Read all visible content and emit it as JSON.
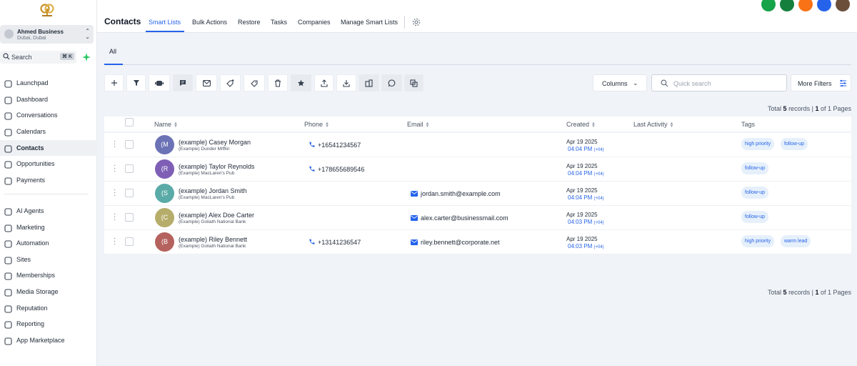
{
  "brand": {
    "logo_icon": "company-logo-icon",
    "accent": "#2563eb"
  },
  "account": {
    "name": "Ahmed Business",
    "location": "Dubai, Dubai"
  },
  "search": {
    "label": "Search",
    "shortcut": "⌘ K"
  },
  "sidebar": {
    "items": [
      {
        "label": "Launchpad",
        "icon": "rocket-icon",
        "active": false
      },
      {
        "label": "Dashboard",
        "icon": "grid-icon",
        "active": false
      },
      {
        "label": "Conversations",
        "icon": "chat-icon",
        "active": false
      },
      {
        "label": "Calendars",
        "icon": "calendar-icon",
        "active": false
      },
      {
        "label": "Contacts",
        "icon": "contacts-icon",
        "active": true
      },
      {
        "label": "Opportunities",
        "icon": "opportunities-icon",
        "active": false
      },
      {
        "label": "Payments",
        "icon": "payments-icon",
        "active": false
      },
      {
        "label": "AI Agents",
        "icon": "ai-agents-icon",
        "active": false
      },
      {
        "label": "Marketing",
        "icon": "marketing-icon",
        "active": false
      },
      {
        "label": "Automation",
        "icon": "automation-icon",
        "active": false
      },
      {
        "label": "Sites",
        "icon": "sites-icon",
        "active": false
      },
      {
        "label": "Memberships",
        "icon": "memberships-icon",
        "active": false
      },
      {
        "label": "Media Storage",
        "icon": "media-icon",
        "active": false
      },
      {
        "label": "Reputation",
        "icon": "star-icon",
        "active": false
      },
      {
        "label": "Reporting",
        "icon": "reporting-icon",
        "active": false
      },
      {
        "label": "App Marketplace",
        "icon": "marketplace-icon",
        "active": false
      }
    ]
  },
  "header": {
    "title": "Contacts",
    "tabs": [
      {
        "label": "Smart Lists",
        "active": true
      },
      {
        "label": "Bulk Actions",
        "active": false
      },
      {
        "label": "Restore",
        "active": false
      },
      {
        "label": "Tasks",
        "active": false
      },
      {
        "label": "Companies",
        "active": false
      },
      {
        "label": "Manage Smart Lists",
        "active": false
      }
    ],
    "top_buttons": [
      {
        "icon": "phone-icon",
        "color": "#16a34a"
      },
      {
        "icon": "megaphone-icon",
        "color": "#15803d"
      },
      {
        "icon": "bell-icon",
        "color": "#f97316"
      },
      {
        "icon": "help-icon",
        "color": "#2563eb"
      },
      {
        "icon": "user-avatar-icon",
        "color": "#6b4f3a"
      }
    ]
  },
  "list": {
    "view_tab": "All",
    "columns_button": "Columns",
    "quick_search_placeholder": "Quick search",
    "more_filters": "More Filters",
    "toolbar_icons": [
      "add-icon",
      "filter-icon",
      "robot-icon",
      "message-icon",
      "email-icon",
      "tag-add-icon",
      "tag-remove-icon",
      "delete-icon",
      "star-icon",
      "export-icon",
      "import-icon",
      "company-icon",
      "whatsapp-icon",
      "merge-icon"
    ]
  },
  "pagination": {
    "prefix": "Total",
    "count": "5",
    "records": "records |",
    "page": "1",
    "of": "of 1 Pages"
  },
  "table": {
    "headers": {
      "name": "Name",
      "phone": "Phone",
      "email": "Email",
      "created": "Created",
      "last_activity": "Last Activity",
      "tags": "Tags"
    },
    "rows": [
      {
        "initial": "(M",
        "avatar_color": "#6b72b5",
        "name": "(example) Casey Morgan",
        "company": "(Example) Dunder Mifflin",
        "phone": "+16541234567",
        "email": "",
        "created_date": "Apr 19 2025",
        "created_time": "04:04 PM",
        "tz": "(+04)",
        "tags": [
          "high priority",
          "follow-up"
        ]
      },
      {
        "initial": "(R",
        "avatar_color": "#7e5fb5",
        "name": "(example) Taylor Reynolds",
        "company": "(Example) MacLaren's Pub",
        "phone": "+178655689546",
        "email": "",
        "created_date": "Apr 19 2025",
        "created_time": "04:04 PM",
        "tz": "(+04)",
        "tags": [
          "follow-up"
        ]
      },
      {
        "initial": "(S",
        "avatar_color": "#5aaba8",
        "name": "(example) Jordan Smith",
        "company": "(Example) MacLaren's Pub",
        "phone": "",
        "email": "jordan.smith@example.com",
        "created_date": "Apr 19 2025",
        "created_time": "04:04 PM",
        "tz": "(+04)",
        "tags": [
          "follow-up"
        ]
      },
      {
        "initial": "(C",
        "avatar_color": "#b6ad6b",
        "name": "(example) Alex Doe Carter",
        "company": "(Example) Goliath National Bank",
        "phone": "",
        "email": "alex.carter@businessmail.com",
        "created_date": "Apr 19 2025",
        "created_time": "04:03 PM",
        "tz": "(+04)",
        "tags": [
          "follow-up"
        ]
      },
      {
        "initial": "(B",
        "avatar_color": "#b5625e",
        "name": "(example) Riley Bennett",
        "company": "(Example) Goliath National Bank",
        "phone": "+13141236547",
        "email": "riley.bennett@corporate.net",
        "created_date": "Apr 19 2025",
        "created_time": "04:03 PM",
        "tz": "(+04)",
        "tags": [
          "high priority",
          "warm lead"
        ]
      }
    ]
  }
}
